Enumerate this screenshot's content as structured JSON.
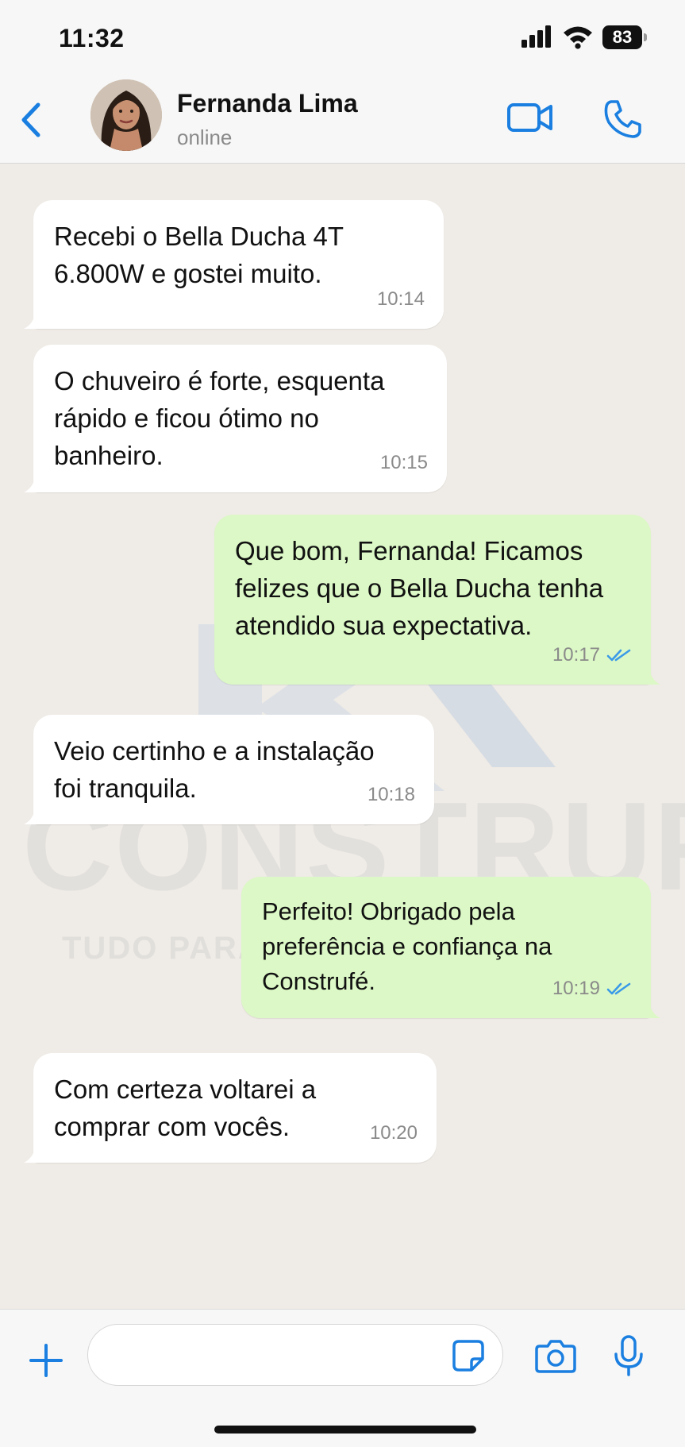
{
  "status_bar": {
    "time": "11:32",
    "battery": "83",
    "icons": [
      "signal-icon",
      "wifi-icon",
      "battery-icon"
    ]
  },
  "header": {
    "contact_name": "Fernanda Lima",
    "contact_status": "online",
    "icons": [
      "back-chevron-icon",
      "avatar",
      "video-call-icon",
      "phone-icon"
    ],
    "accent_color": "#1a7fe0"
  },
  "watermark": {
    "brand": "CONSTRUFÉ",
    "tagline": "TUDO PARA"
  },
  "messages": [
    {
      "direction": "in",
      "text": "Recebi o Bella Ducha 4T 6.800W e gostei muito.",
      "time": "10:14"
    },
    {
      "direction": "in",
      "text": "O chuveiro é forte, esquenta rápido e ficou ótimo no banheiro.",
      "time": "10:15"
    },
    {
      "direction": "out",
      "text": "Que bom, Fernanda! Ficamos felizes que o Bella Ducha tenha atendido sua expectativa.",
      "time": "10:17",
      "read": true
    },
    {
      "direction": "in",
      "text": "Veio certinho e a instalação foi tranquila.",
      "time": "10:18"
    },
    {
      "direction": "out",
      "text": "Perfeito! Obrigado pela preferência e confiança na Construfé.",
      "time": "10:19",
      "read": true
    },
    {
      "direction": "in",
      "text": "Com certeza voltarei a comprar com vocês.",
      "time": "10:20"
    }
  ],
  "input_bar": {
    "message_value": "",
    "icons": [
      "plus-icon",
      "sticker-icon",
      "camera-icon",
      "microphone-icon"
    ]
  },
  "colors": {
    "incoming_bubble": "#ffffff",
    "outgoing_bubble": "#dcf8c6",
    "read_ticks": "#3a9ae8",
    "chat_background": "#efebe6"
  }
}
